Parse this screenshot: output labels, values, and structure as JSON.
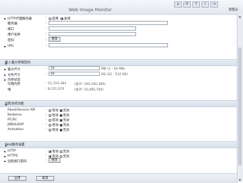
{
  "header": {
    "title": "Web Image Monitor",
    "admin_label": "管理员",
    "icons": [
      "home-icon",
      "refresh-icon",
      "help-icon",
      "info-icon",
      "logout-icon"
    ],
    "icon_glyphs": [
      "⌂",
      "⟳",
      "?",
      "i",
      "⇥"
    ]
  },
  "section_general": {
    "https_label": "HTTP代理服务器",
    "https_on": "启用",
    "https_off": "关闭",
    "fields": [
      {
        "label": "服务器",
        "value": ""
      },
      {
        "label": "端口",
        "value": ""
      },
      {
        "label": "用户名称",
        "value": ""
      },
      {
        "label": "密码",
        "button": "更改"
      }
    ],
    "url_label": "URL"
  },
  "section_size": {
    "title": "每人最大存储空间",
    "rows": [
      {
        "label": "最大尺寸",
        "value": "10",
        "unit": "MB (1 - 44 MB)"
      },
      {
        "label": "文件尺寸",
        "value": "64",
        "unit": "KB (32 - 512 KB)"
      }
    ],
    "memory_label": "内存状态",
    "free_label": "可用内存",
    "free_value": ": 51,216,384",
    "free_total": "(总计: 244,240,384)",
    "heap_label": "堆",
    "heap_value": ": 8,151,070",
    "heap_total": "(总计: 10,485,760)"
  },
  "section_api": {
    "title": "远程访问功能",
    "items": [
      {
        "label": "Panel/Service API",
        "on": "有效",
        "off": "无效",
        "on_checked": true
      },
      {
        "label": "Kerberos",
        "on": "有效",
        "off": "无效",
        "on_checked": true
      },
      {
        "label": "PC/SC",
        "on": "有效",
        "off": "无效",
        "on_checked": true
      },
      {
        "label": "JNDI/LDAP",
        "on": "有效",
        "off": "无效",
        "on_checked": true
      },
      {
        "label": "Activation",
        "on": "有效",
        "off": "无效",
        "on_checked": true
      }
    ]
  },
  "section_web": {
    "title": "Web服务设置",
    "items": [
      {
        "label": "HTTP",
        "on": "有效",
        "off": "无效",
        "on_checked": true
      },
      {
        "label": "HTTPS",
        "on": "有效",
        "off": "无效",
        "on_checked": true
      }
    ],
    "password_label": "远程接口密码",
    "password_button": "更改"
  },
  "footer": {
    "apply": "应用",
    "cancel": "取消"
  }
}
